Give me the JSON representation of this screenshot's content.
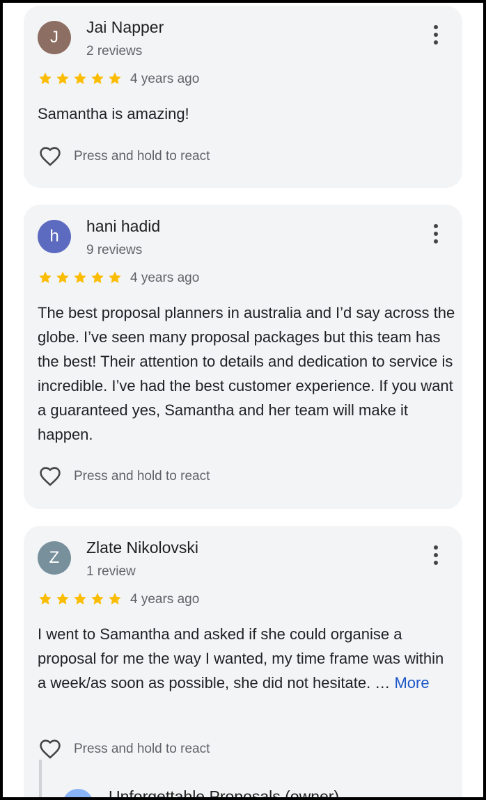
{
  "reviews": [
    {
      "initial": "J",
      "avatar_color": "#8d6e63",
      "name": "Jai Napper",
      "count": "2 reviews",
      "rating": 5,
      "when": "4 years ago",
      "text": "Samantha is amazing!",
      "react": "Press and hold to react"
    },
    {
      "initial": "h",
      "avatar_color": "#5c6bc0",
      "name": "hani hadid",
      "count": "9 reviews",
      "rating": 5,
      "when": "4 years ago",
      "text": "The best proposal planners in australia and I’d say across the globe. I’ve seen many proposal packages but this team has the best! Their attention to details and dedication to service is incredible. I’ve had the best customer experience. If you want a guaranteed yes, Samantha and her team will make it happen.",
      "react": "Press and hold to react"
    },
    {
      "initial": "Z",
      "avatar_color": "#78909c",
      "name": "Zlate Nikolovski",
      "count": "1 review",
      "rating": 5,
      "when": "4 years ago",
      "text": "I went to Samantha and asked if she could organise a proposal for me the way I wanted, my time frame was within a week/as soon as possible, she did not hesitate. …",
      "more": "More",
      "react": "Press and hold to react"
    }
  ],
  "reply": {
    "name": "Unforgettable Proposals (owner)"
  },
  "colors": {
    "star": "#fbbc04",
    "link": "#1a57c8"
  }
}
